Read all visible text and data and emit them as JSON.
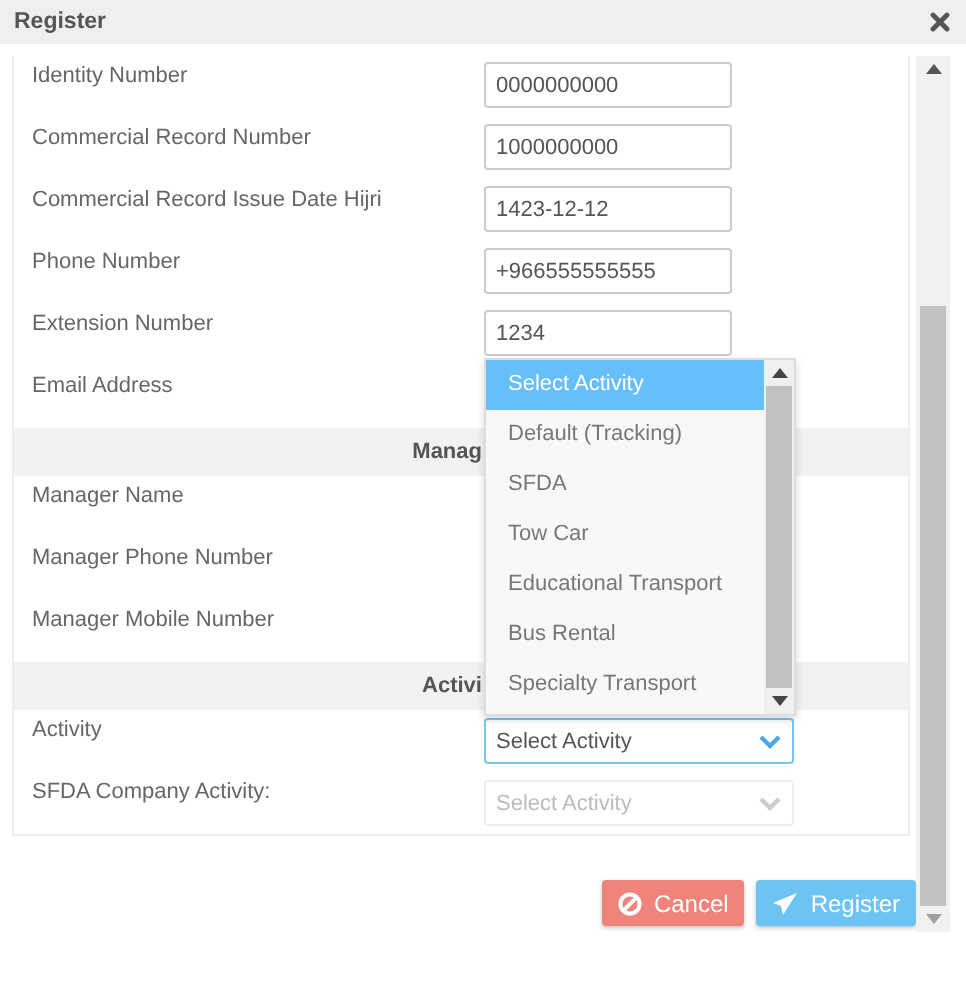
{
  "window": {
    "title": "Register"
  },
  "form": [
    {
      "kind": "field",
      "label": "Identity Number",
      "value": "0000000000"
    },
    {
      "kind": "field",
      "label": "Commercial Record Number",
      "value": "1000000000"
    },
    {
      "kind": "field",
      "label": "Commercial Record Issue Date Hijri",
      "value": "1423-12-12"
    },
    {
      "kind": "field",
      "label": "Phone Number",
      "value": "+966555555555"
    },
    {
      "kind": "field",
      "label": "Extension Number",
      "value": "1234"
    },
    {
      "kind": "field",
      "label": "Email Address"
    },
    {
      "kind": "header",
      "text": "Manag"
    },
    {
      "kind": "field",
      "label": "Manager Name"
    },
    {
      "kind": "field",
      "label": "Manager Phone Number"
    },
    {
      "kind": "field",
      "label": "Manager Mobile Number"
    },
    {
      "kind": "header",
      "text": "Activi"
    },
    {
      "kind": "select",
      "label": "Activity",
      "value": "Select Activity",
      "disabled": false
    },
    {
      "kind": "select",
      "label": "SFDA Company Activity:",
      "value": "Select Activity",
      "disabled": true
    }
  ],
  "dropdown": {
    "options": [
      {
        "label": "Select Activity",
        "selected": true
      },
      {
        "label": "Default (Tracking)",
        "selected": false
      },
      {
        "label": "SFDA",
        "selected": false
      },
      {
        "label": "Tow Car",
        "selected": false
      },
      {
        "label": "Educational Transport",
        "selected": false
      },
      {
        "label": "Bus Rental",
        "selected": false
      },
      {
        "label": "Specialty Transport",
        "selected": false
      }
    ]
  },
  "buttons": [
    {
      "kind": "cancel",
      "label": "Cancel"
    },
    {
      "kind": "submit",
      "label": "Register"
    }
  ]
}
